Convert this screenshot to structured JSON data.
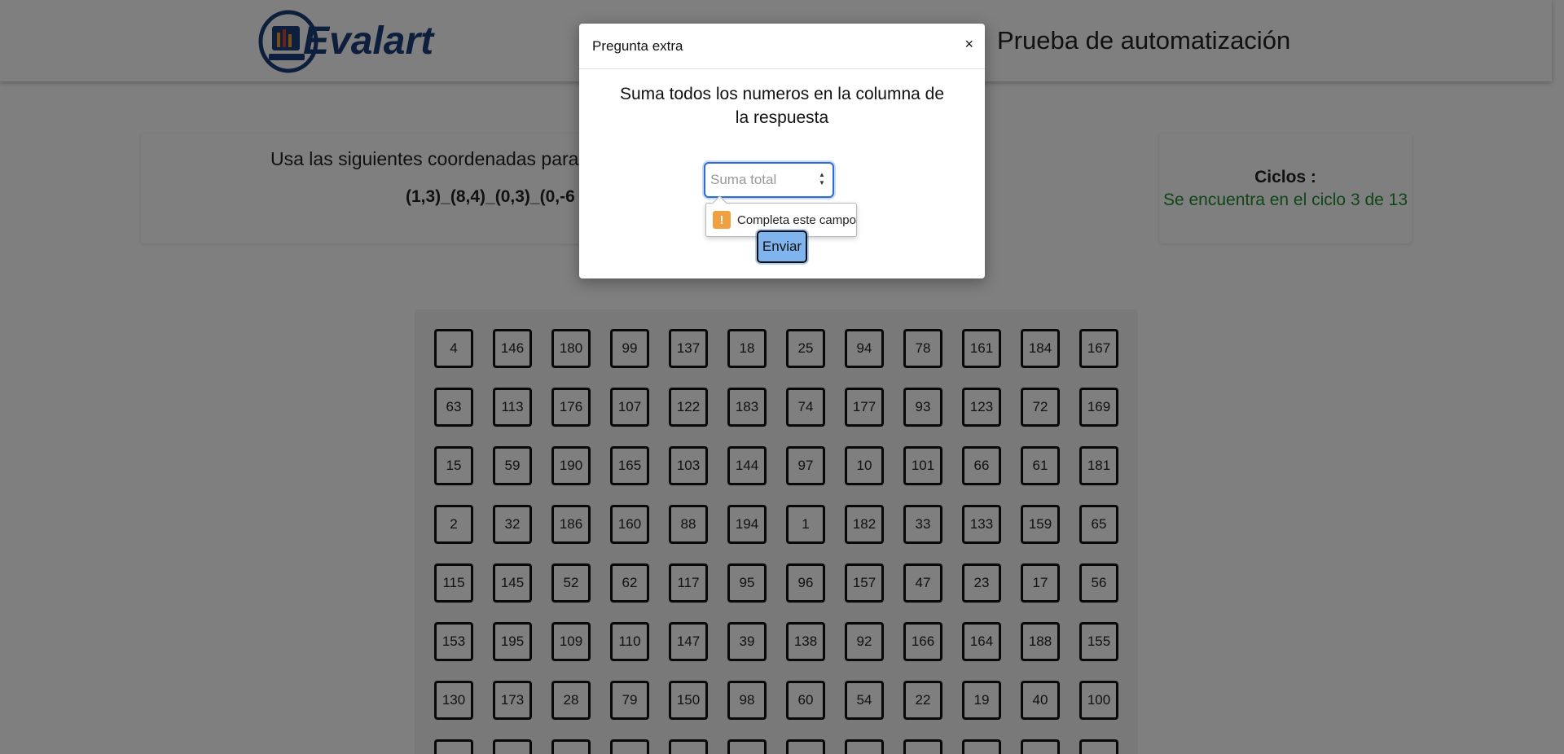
{
  "header": {
    "logo_text": "Evalart",
    "title": "Prueba de automatización"
  },
  "instructions": {
    "text": "Usa las siguientes coordenadas para",
    "coordinates": "(1,3)_(8,4)_(0,3)_(0,-6"
  },
  "cycles": {
    "label": "Ciclos :",
    "value": "Se encuentra en el ciclo 3 de 13",
    "value_color": "#1e8a32"
  },
  "grid": {
    "rows": [
      [
        "4",
        "146",
        "180",
        "99",
        "137",
        "18",
        "25",
        "94",
        "78",
        "161",
        "184",
        "167"
      ],
      [
        "63",
        "113",
        "176",
        "107",
        "122",
        "183",
        "74",
        "177",
        "93",
        "123",
        "72",
        "169"
      ],
      [
        "15",
        "59",
        "190",
        "165",
        "103",
        "144",
        "97",
        "10",
        "101",
        "66",
        "61",
        "181"
      ],
      [
        "2",
        "32",
        "186",
        "160",
        "88",
        "194",
        "1",
        "182",
        "33",
        "133",
        "159",
        "65"
      ],
      [
        "115",
        "145",
        "52",
        "62",
        "117",
        "95",
        "96",
        "157",
        "47",
        "23",
        "17",
        "56"
      ],
      [
        "153",
        "195",
        "109",
        "110",
        "147",
        "39",
        "138",
        "92",
        "166",
        "164",
        "188",
        "155"
      ],
      [
        "130",
        "173",
        "28",
        "79",
        "150",
        "98",
        "60",
        "54",
        "22",
        "19",
        "40",
        "100"
      ],
      [
        "",
        "",
        "",
        "",
        "",
        "",
        "",
        "",
        "",
        "",
        "",
        ""
      ]
    ]
  },
  "modal": {
    "title": "Pregunta extra",
    "close_symbol": "×",
    "question": "Suma todos los numeros en la columna de la respuesta",
    "input_placeholder": "Suma total",
    "input_value": "",
    "validation_message": "Completa este campo",
    "validation_icon": "warning-icon",
    "submit_label": "Enviar",
    "submit_color": "#7fb4ef"
  }
}
